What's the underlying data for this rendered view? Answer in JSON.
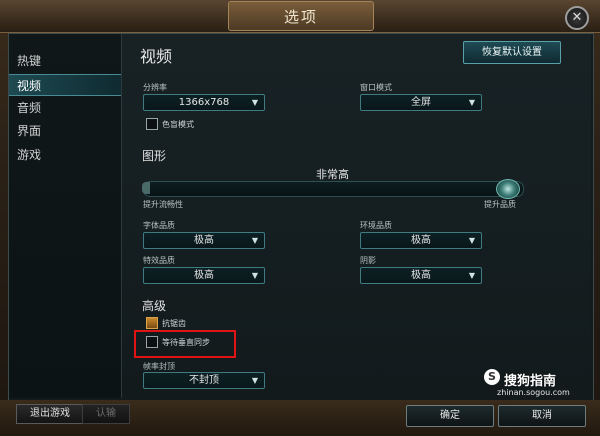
{
  "window": {
    "title": "选项",
    "close_glyph": "✕"
  },
  "sidebar": {
    "items": [
      {
        "label": "热键",
        "active": false
      },
      {
        "label": "视频",
        "active": true
      },
      {
        "label": "音频",
        "active": false
      },
      {
        "label": "界面",
        "active": false
      },
      {
        "label": "游戏",
        "active": false
      }
    ]
  },
  "video": {
    "title": "视频",
    "reset_label": "恢复默认设置",
    "resolution": {
      "label": "分辨率",
      "value": "1366x768"
    },
    "window_mode": {
      "label": "窗口模式",
      "value": "全屏"
    },
    "colorblind": {
      "label": "色盲模式",
      "checked": false
    }
  },
  "graphics": {
    "title": "图形",
    "quality": {
      "value": "非常高",
      "left_label": "提升流畅性",
      "right_label": "提升品质",
      "level": 1.0
    },
    "character_quality": {
      "label": "字体品质",
      "value": "极高"
    },
    "environment_quality": {
      "label": "环境品质",
      "value": "极高"
    },
    "effects_quality": {
      "label": "特效品质",
      "value": "极高"
    },
    "shadows": {
      "label": "阴影",
      "value": "极高"
    }
  },
  "advanced": {
    "title": "高级",
    "antialiasing": {
      "label": "抗锯齿",
      "checked": true
    },
    "vsync": {
      "label": "等待垂直同步",
      "checked": false
    },
    "framerate_cap": {
      "label": "帧率封顶",
      "value": "不封顶"
    }
  },
  "footer": {
    "exit_label": "退出游戏",
    "surrender_label": "认输",
    "ok_label": "确定",
    "cancel_label": "取消"
  },
  "watermark": {
    "s": "S",
    "brand": "搜狗指南",
    "url": "zhinan.sogou.com"
  },
  "icons": {
    "dropdown_arrow": "▼"
  },
  "colors": {
    "accent": "#3f7b80",
    "highlight_box": "#e01414"
  }
}
